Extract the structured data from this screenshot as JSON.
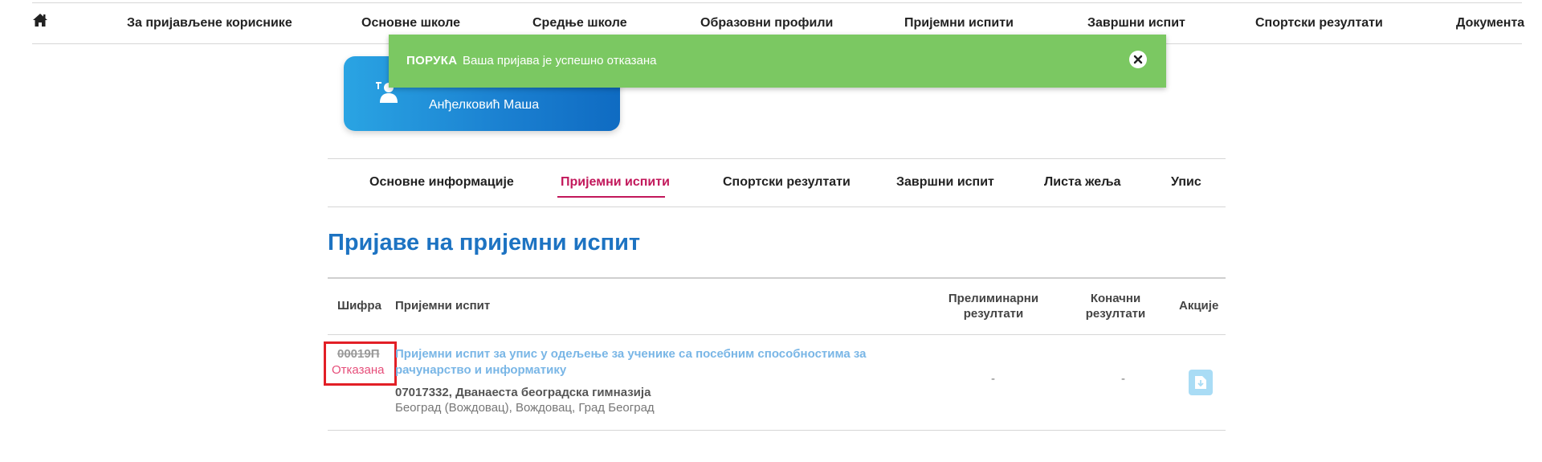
{
  "topnav": {
    "items": [
      "За пријављене кориснике",
      "Основне школе",
      "Средње школе",
      "Образовни профили",
      "Пријемни испити",
      "Завршни испит",
      "Спортски резултати",
      "Документа"
    ]
  },
  "toast": {
    "label": "ПОРУКА",
    "message": "Ваша пријава је успешно отказана"
  },
  "user": {
    "name": "Анђелковић Маша"
  },
  "subtabs": {
    "items": [
      "Основне информације",
      "Пријемни испити",
      "Спортски резултати",
      "Завршни испит",
      "Листа жеља",
      "Упис"
    ],
    "active": "Пријемни испити"
  },
  "page": {
    "title": "Пријаве на пријемни испит"
  },
  "table": {
    "headers": {
      "code": "Шифра",
      "exam": "Пријемни испит",
      "prelim_line1": "Прелиминарни",
      "prelim_line2": "резултати",
      "final_line1": "Коначни",
      "final_line2": "резултати",
      "actions": "Акције"
    },
    "rows": [
      {
        "code": "00019П",
        "status": "Отказана",
        "exam": "Пријемни испит за упис у одељење за ученике са посебним способностима за рачунарство и информатику",
        "school": "07017332, Дванаеста београдска гимназија",
        "location": "Београд (Вождовац), Вождовац, Град Београд",
        "prelim": "-",
        "final": "-"
      }
    ]
  },
  "colors": {
    "accent_blue": "#1d73c2",
    "active_tab": "#c2185b",
    "toast_green": "#7bc862",
    "highlight_red": "#e21f26",
    "cancelled_pink": "#e64d79"
  }
}
